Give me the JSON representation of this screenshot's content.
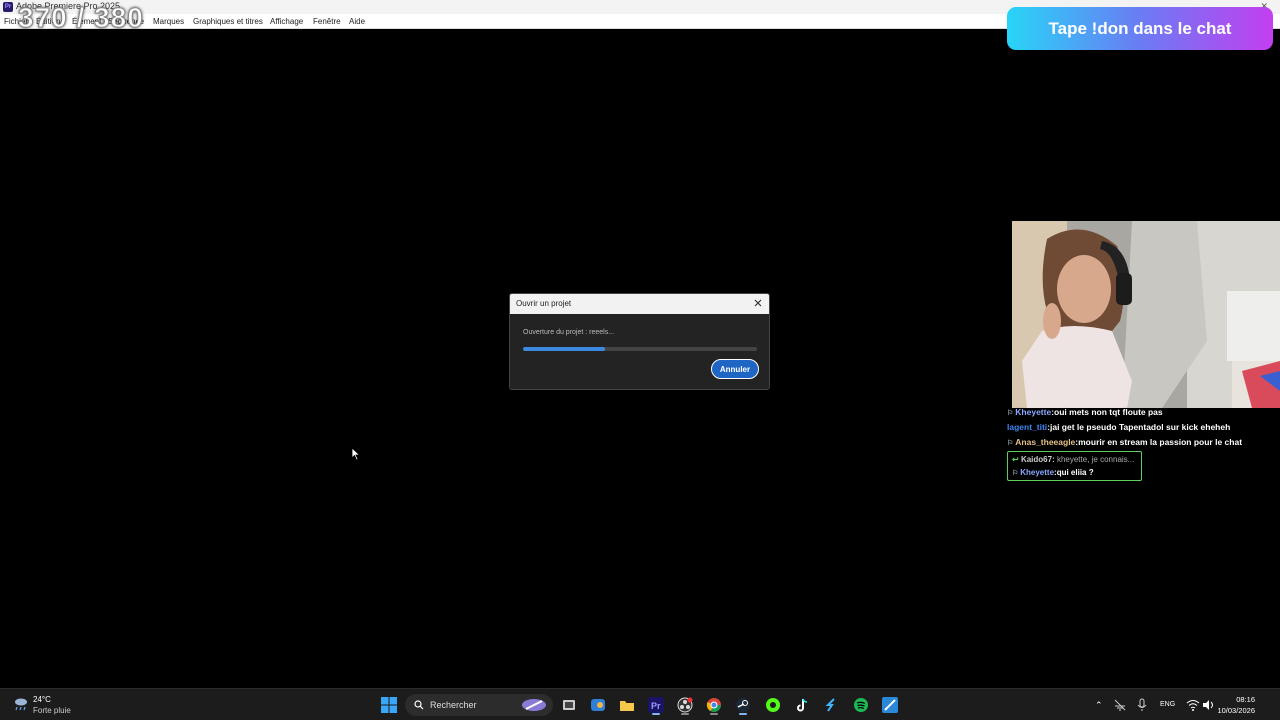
{
  "window": {
    "title": "Adobe Premiere Pro 2025",
    "app_icon": "Pr",
    "menu": [
      {
        "label": "Fichier"
      },
      {
        "label": "Édition"
      },
      {
        "label": "Élément"
      },
      {
        "label": "Séquence"
      },
      {
        "label": "Marques"
      },
      {
        "label": "Graphiques et titres"
      },
      {
        "label": "Affichage"
      },
      {
        "label": "Fenêtre"
      },
      {
        "label": "Aide"
      }
    ]
  },
  "overlay": {
    "counter": "370 / 380",
    "don_banner": "Tape !don dans le chat"
  },
  "dialog": {
    "title": "Ouvrir un projet",
    "status": "Ouverture du projet : reeels...",
    "progress": 0.35,
    "cancel_label": "Annuler"
  },
  "chat": {
    "messages": [
      {
        "user": "Kheyette",
        "text": "oui mets non tqt floute pas",
        "user_color": "#8aa6ff",
        "badge": true
      },
      {
        "user": "lagent_titi",
        "text": "jai get le pseudo Tapentadol sur kick eheheh",
        "user_color": "#3f86f0",
        "badge": false
      },
      {
        "user": "Anas_theeagle",
        "text": "mourir en stream la passion pour le chat",
        "user_color": "#e8c18a",
        "badge": true
      }
    ],
    "reply": {
      "reply_to_user": "Kaido67",
      "reply_to_text": "kheyette, je connais...",
      "user": "Kheyette",
      "text": "qui eliia ?",
      "user_color": "#8aa6ff"
    }
  },
  "taskbar": {
    "weather_temp": "24°C",
    "weather_condition": "Forte pluie",
    "search_label": "Rechercher",
    "language": "ENG",
    "time": "08:16",
    "date": "10/03/2026"
  },
  "colors": {
    "accent": "#1f65c4",
    "progress": "#3c8ae0",
    "taskbar_bg": "#1c1c1c"
  }
}
